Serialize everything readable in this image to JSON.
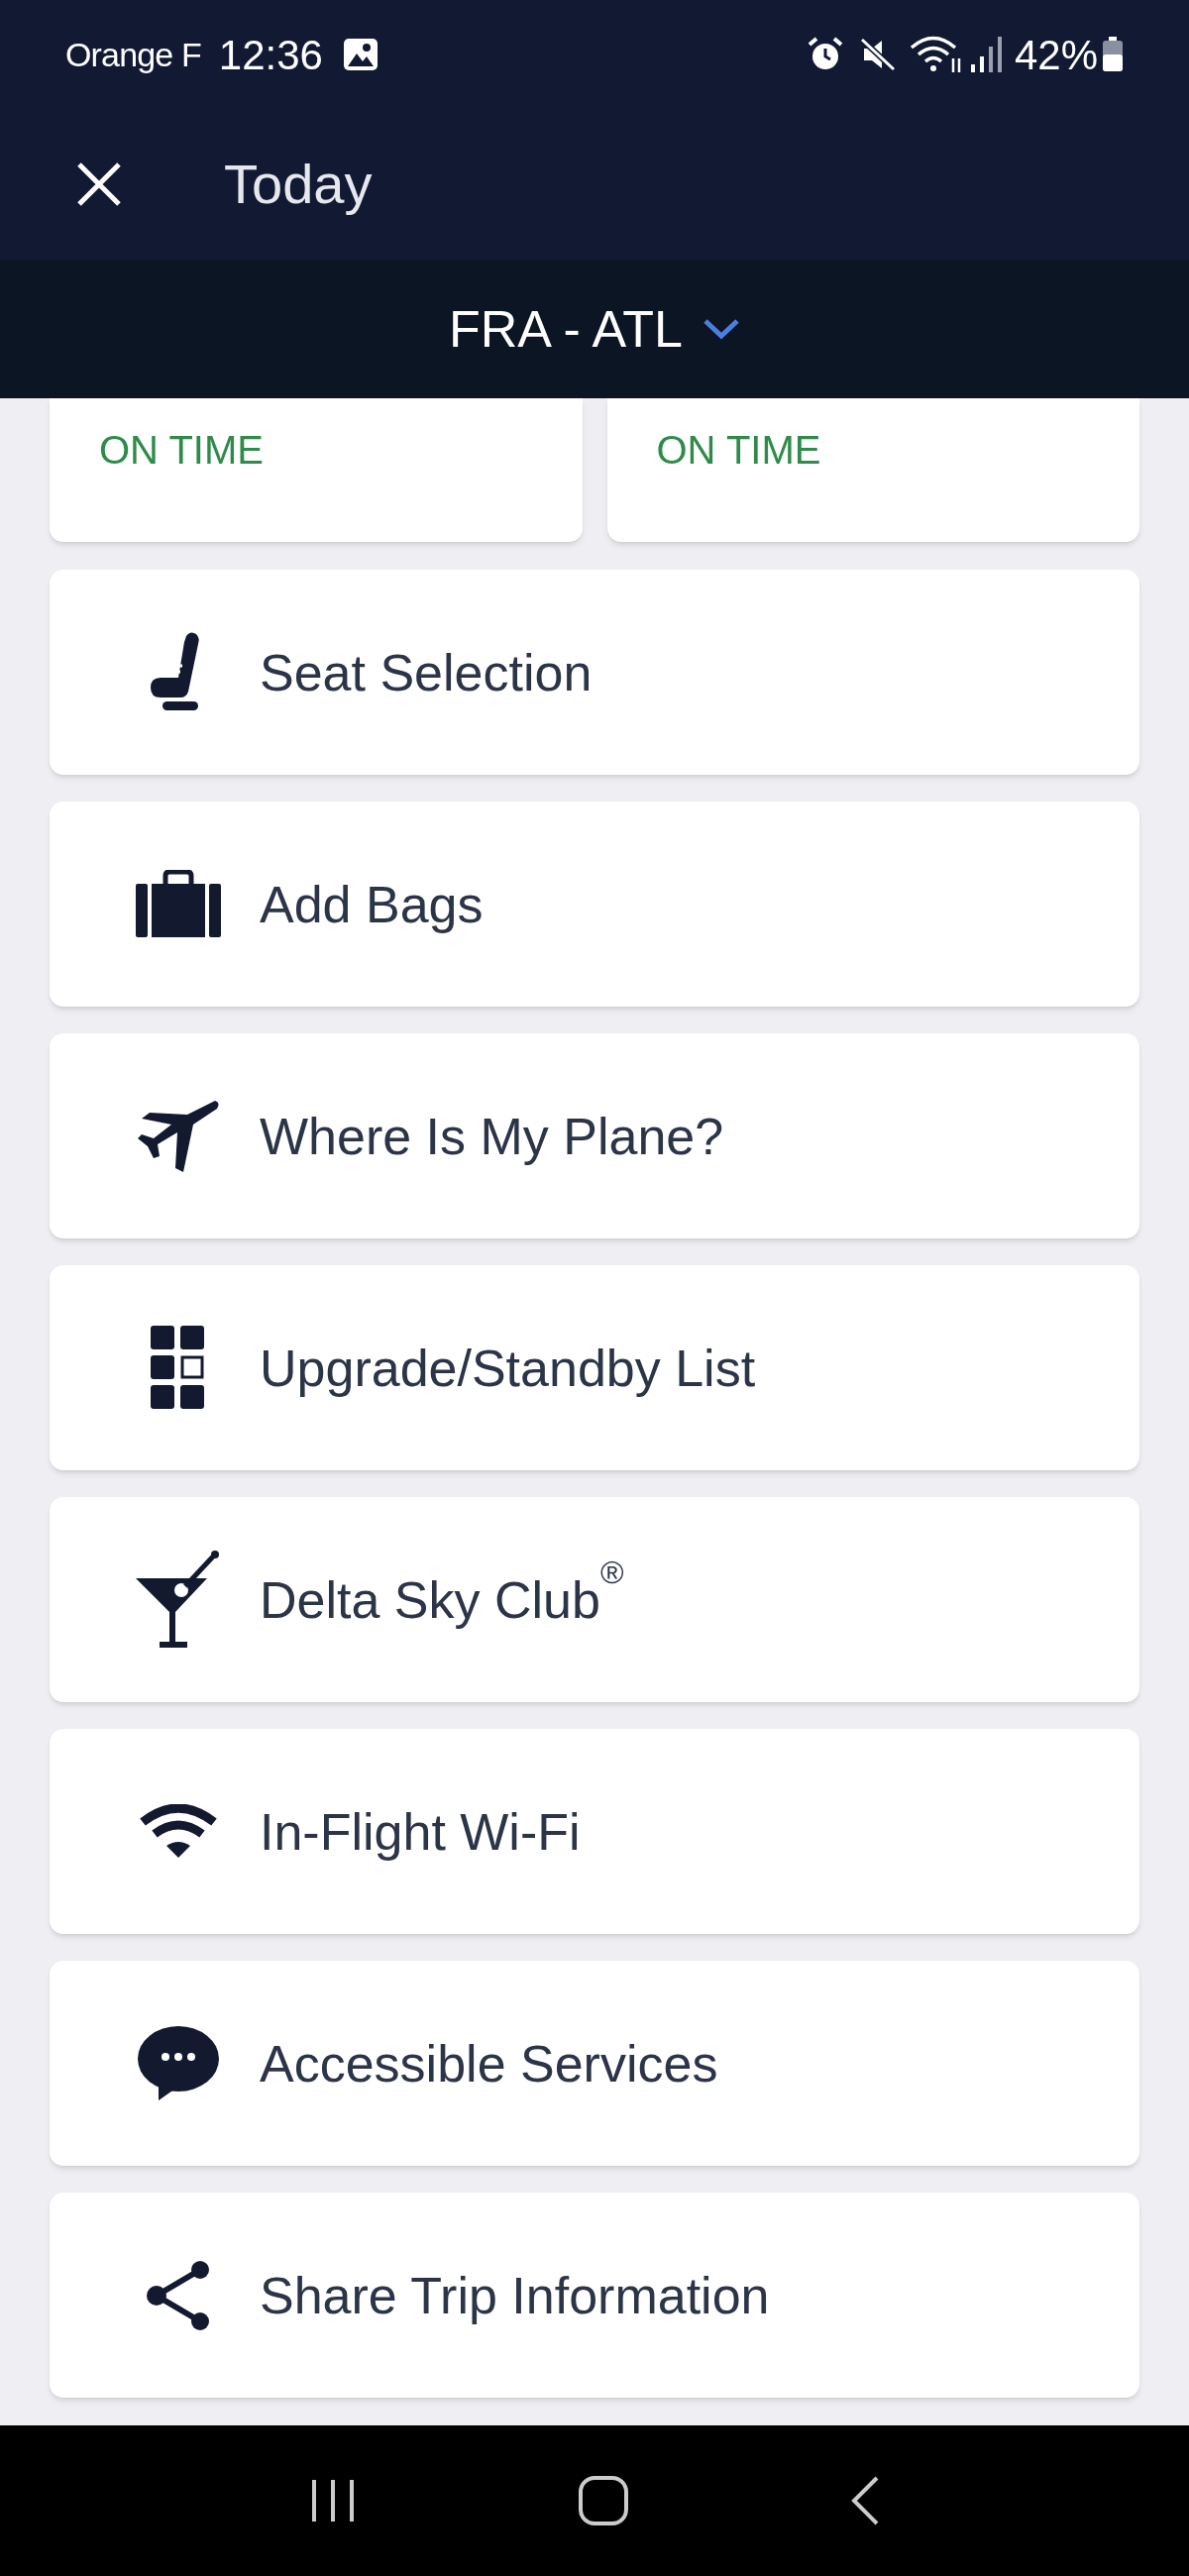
{
  "status_bar": {
    "carrier": "Orange F",
    "time": "12:36",
    "battery": "42%"
  },
  "header": {
    "title": "Today"
  },
  "route": {
    "label": "FRA - ATL"
  },
  "flight_status_cards": [
    {
      "status": "ON TIME"
    },
    {
      "status": "ON TIME"
    }
  ],
  "menu_items": [
    {
      "kind": "seat",
      "label": "Seat Selection"
    },
    {
      "kind": "bags",
      "label": "Add Bags"
    },
    {
      "kind": "plane",
      "label": "Where Is My Plane?"
    },
    {
      "kind": "grid",
      "label": "Upgrade/Standby List"
    },
    {
      "kind": "cocktail",
      "label": "Delta Sky Club$^{®}$"
    },
    {
      "kind": "wifi",
      "label": "In-Flight Wi-Fi"
    },
    {
      "kind": "chat",
      "label": "Accessible Services"
    },
    {
      "kind": "share",
      "label": "Share Trip Information"
    }
  ]
}
